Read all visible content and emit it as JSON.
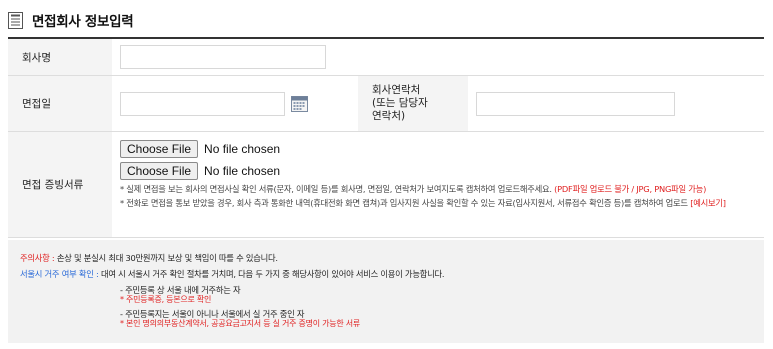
{
  "section": {
    "title": "면접회사 정보입력",
    "icon": "document-list-icon"
  },
  "fields": {
    "company_name": {
      "label": "회사명",
      "value": ""
    },
    "interview_date": {
      "label": "면접일",
      "value": "",
      "icon": "calendar-icon"
    },
    "company_contact": {
      "label_lines": [
        "회사연락처",
        "(또는 담당자",
        "연락처)"
      ],
      "value": ""
    },
    "evidence": {
      "label": "면접 증빙서류",
      "files": [
        {
          "button": "Choose File",
          "status": "No file chosen"
        },
        {
          "button": "Choose File",
          "status": "No file chosen"
        }
      ],
      "note1_text": "* 실제 면접을 보는 회사의 면접사실 확인 서류(문자, 이메일 등)를 회사명, 면접일, 연락처가 보여지도록 캡처하여 업로드해주세요.",
      "note1_highlight": "(PDF파일 업로드 불가 / JPG, PNG파일 가능)",
      "note2_text": "* 전화로 면접을 통보 받았을 경우, 회사 측과 통화한 내역(휴대전화 화면 캡쳐)과 입사지원 사실을 확인할 수 있는 자료(입사지원서, 서류접수 확인증 등)를 캡쳐하여 업로드",
      "note2_link": "[예시보기]"
    }
  },
  "notice": {
    "caution_label": "주의사항 :",
    "caution_text": "손상 및 분실시 최대 30만원까지 보상 및 책임이 따를 수 있습니다.",
    "residence_label": "서울시 거주 여부 확인 :",
    "residence_text": "대여 시 서울시 거주 확인 절차를 거치며, 다음 두 가지 중 해당사항이 있어야 서비스 이용이 가능합니다.",
    "option1": "- 주민등록 상 서울 내에 거주하는 자",
    "option1_note": "* 주민등록증, 등본으로 확인",
    "option2": "- 주민등록지는 서울이 아니나 서울에서 실 거주 중인 자",
    "option2_note": "* 본인 명의의부동산계약서, 공공요금고지서 등 실 거주 증명이 가능한 서류"
  },
  "colors": {
    "highlight_red": "#e02020",
    "notice_blue": "#2a6ad8",
    "label_bg": "#f4f4f4"
  }
}
